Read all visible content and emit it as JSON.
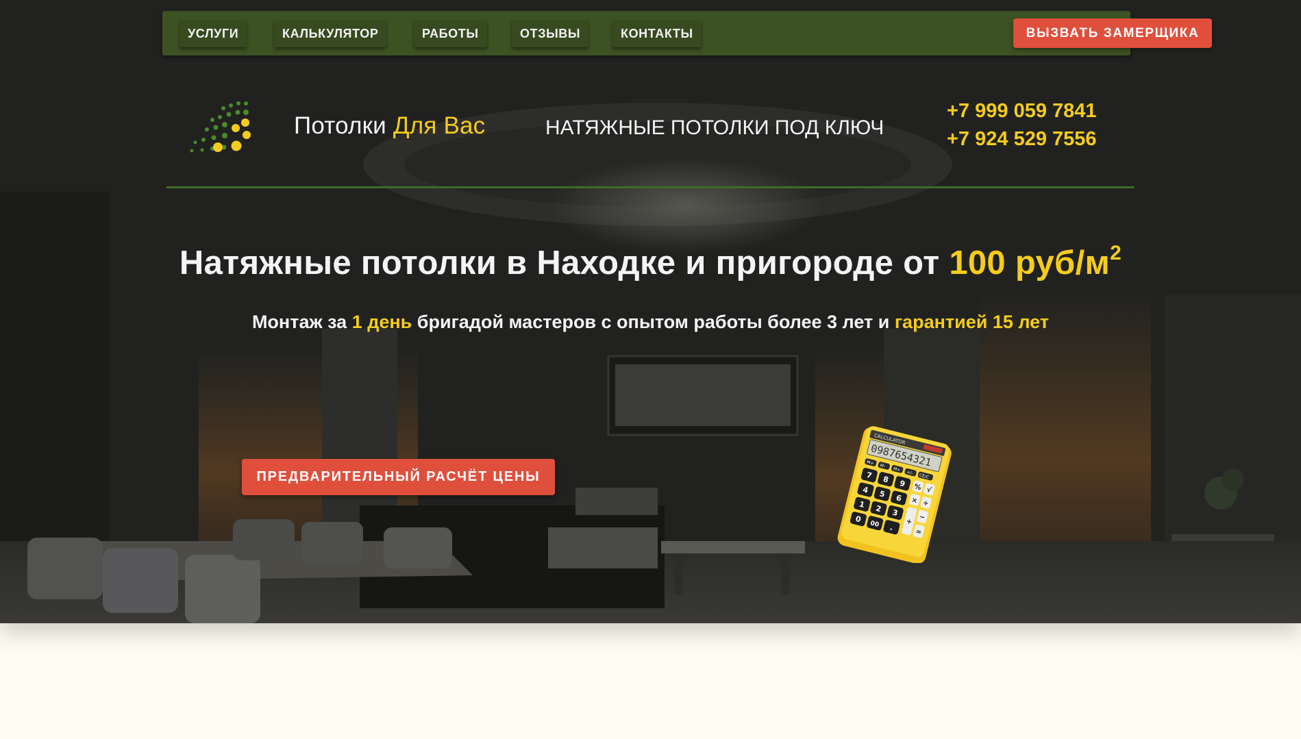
{
  "nav": {
    "items": [
      {
        "label": "УСЛУГИ"
      },
      {
        "label": "КАЛЬКУЛЯТОР"
      },
      {
        "label": "РАБОТЫ"
      },
      {
        "label": "ОТЗЫВЫ"
      },
      {
        "label": "КОНТАКТЫ"
      }
    ],
    "cta_label": "ВЫЗВАТЬ ЗАМЕРЩИКА"
  },
  "header": {
    "brand_prefix": "Потолки",
    "brand_accent_1": "Для",
    "brand_accent_2": "Вас",
    "tagline": "НАТЯЖНЫЕ ПОТОЛКИ ПОД КЛЮЧ",
    "phones": [
      "+7 999 059 7841",
      "+7 924  529 7556"
    ]
  },
  "hero": {
    "headline_prefix": "Натяжные потолки в Находке и пригороде от ",
    "headline_price": "100 руб/м",
    "headline_sup": "2",
    "sub_1": "Монтаж за ",
    "sub_2": "1 день",
    "sub_3": " бригадой мастеров с опытом работы более 3 лет и ",
    "sub_4": "гарантией 15 лет",
    "cta_label": "ПРЕДВАРИТЕЛЬНЫЙ РАСЧЁТ ЦЕНЫ"
  },
  "calculator": {
    "display": "0987654321",
    "brand_text": "CALCULATOR",
    "keys": [
      "7",
      "8",
      "9",
      "4",
      "5",
      "6",
      "1",
      "2",
      "3",
      "0",
      "00",
      "."
    ],
    "op_keys": [
      "%",
      "√",
      "×",
      "÷",
      "+",
      "−",
      "="
    ],
    "mem_keys": [
      "M+",
      "M-",
      "M+",
      "+/-",
      "CE/C"
    ]
  },
  "colors": {
    "accent_yellow": "#f5cc1e",
    "nav_green": "#3d5223",
    "cta_red": "#e04f3c",
    "page_bg": "#fdfcf2"
  },
  "icons": {
    "logo": "dot-cluster-logo",
    "calculator": "calculator-illustration"
  }
}
